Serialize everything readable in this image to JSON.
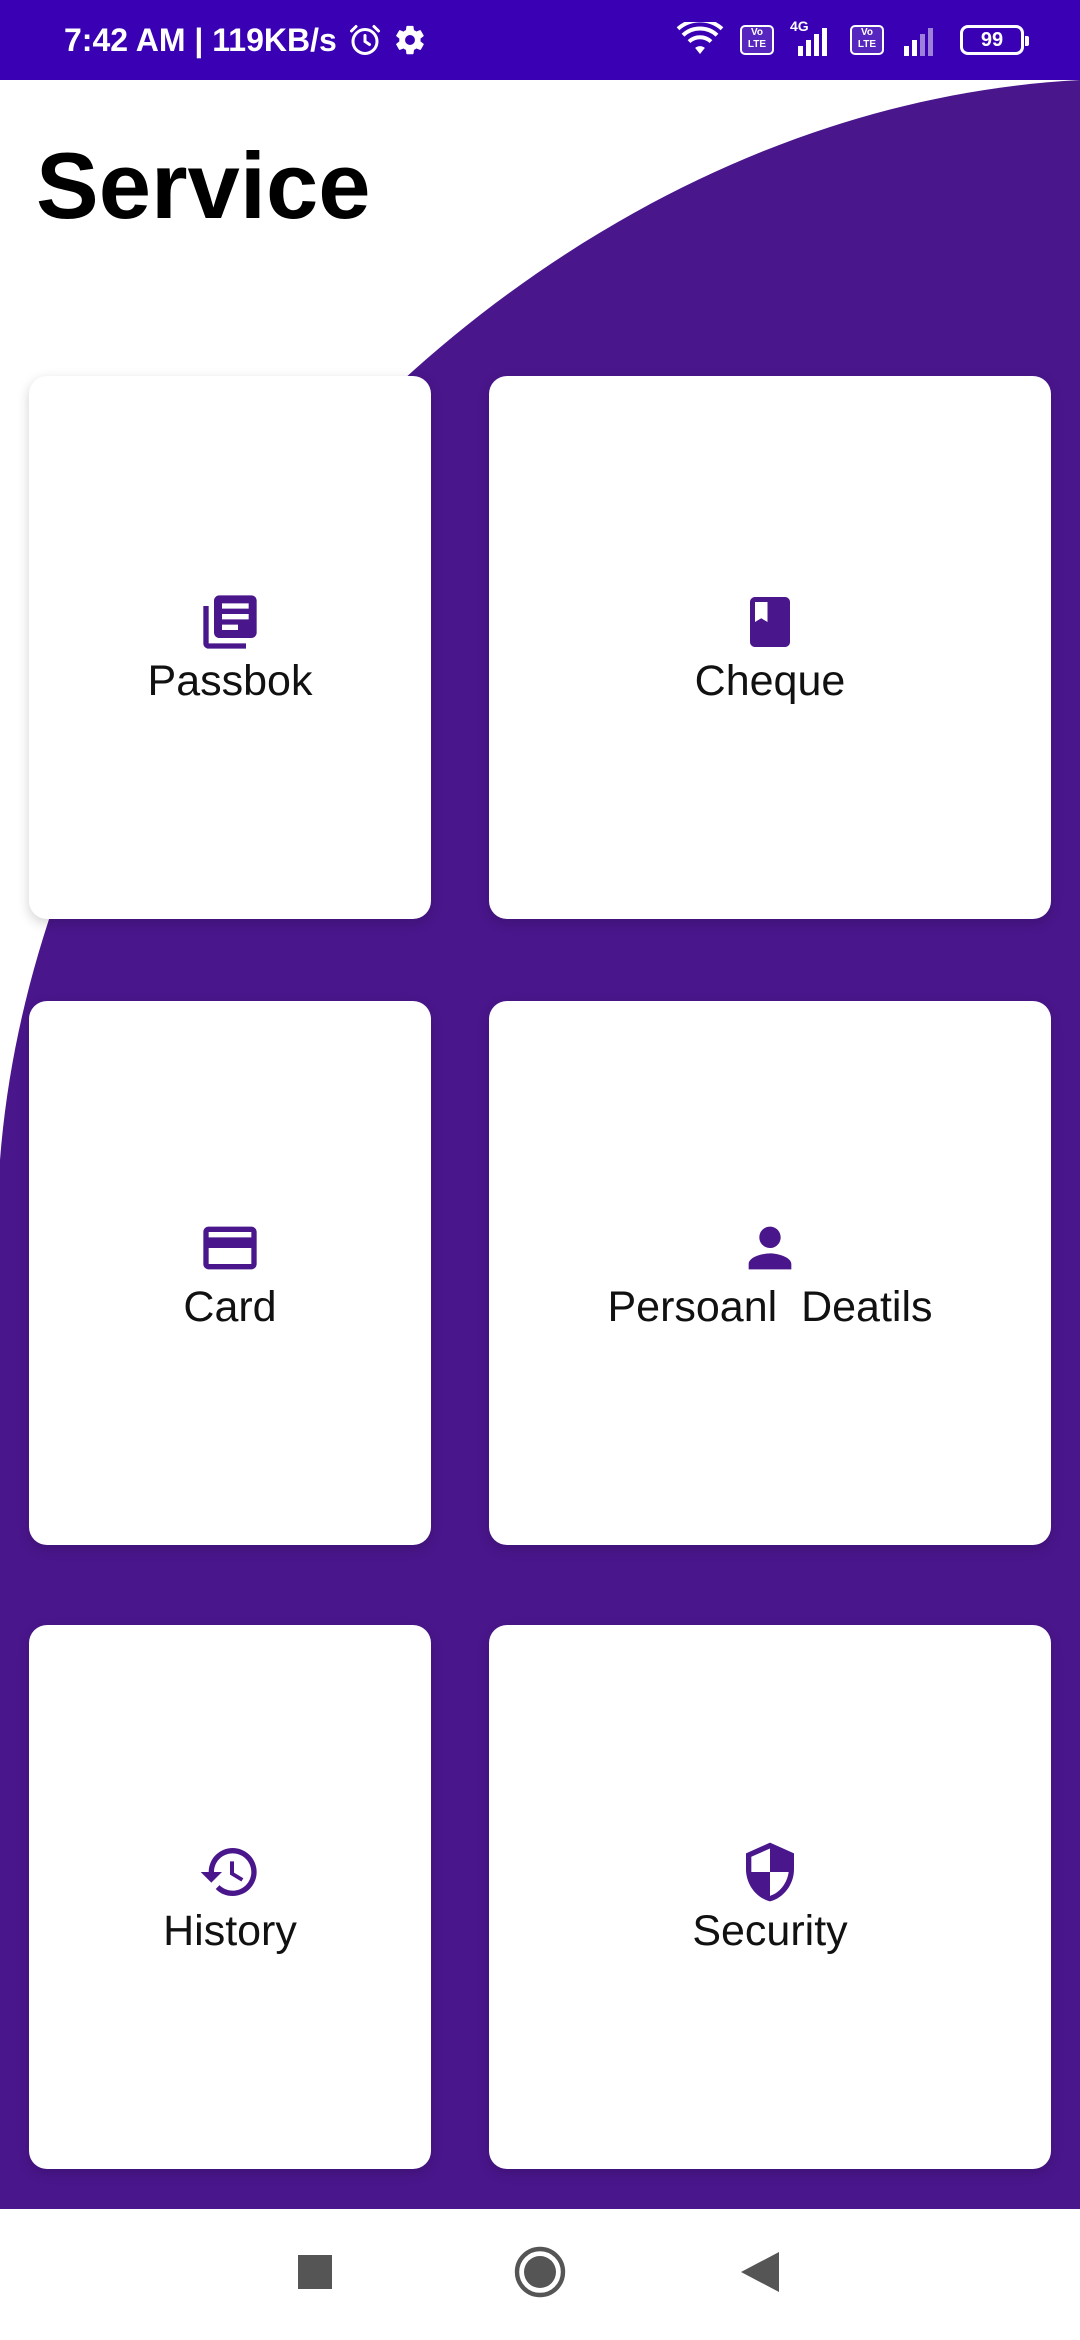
{
  "status_bar": {
    "time_speed": "7:42 AM | 119KB/s",
    "network_type": "4G",
    "lte_badge_top": "Vo",
    "lte_badge_bottom": "LTE",
    "battery": "99"
  },
  "page": {
    "title": "Service"
  },
  "colors": {
    "accent": "#4a168c",
    "status_bar": "#3a00b4",
    "card": "#ffffff"
  },
  "services": [
    {
      "label": "Passbok",
      "icon": "passbook-icon"
    },
    {
      "label": "Cheque",
      "icon": "cheque-book-icon"
    },
    {
      "label": "Card",
      "icon": "credit-card-icon"
    },
    {
      "label": "Persoanl  Deatils",
      "icon": "person-icon"
    },
    {
      "label": "History",
      "icon": "history-icon"
    },
    {
      "label": "Security",
      "icon": "shield-icon"
    }
  ],
  "nav": {
    "recent_icon": "recent-apps-icon",
    "home_icon": "home-icon",
    "back_icon": "back-icon"
  }
}
